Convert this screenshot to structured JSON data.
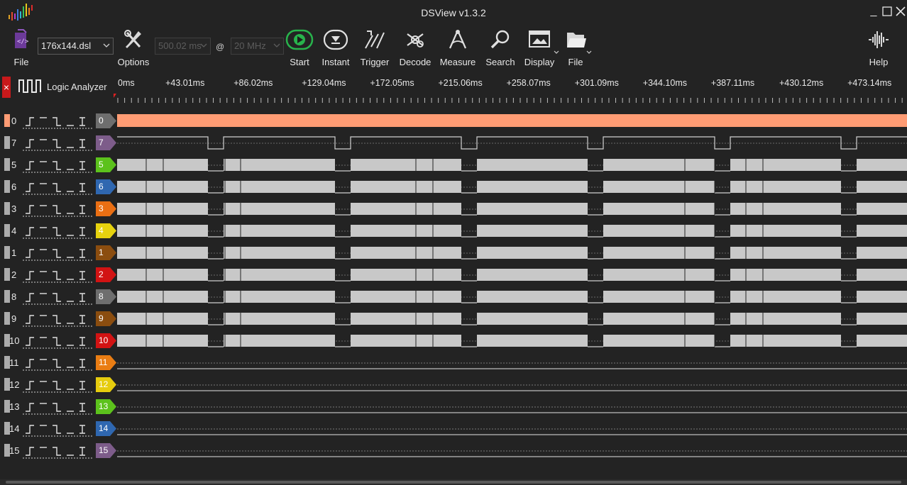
{
  "window": {
    "title": "DSView v1.3.2"
  },
  "toolbar": {
    "file_label": "File",
    "device_file": "176x144.dsl",
    "options_label": "Options",
    "sample_time": "500.02 ms",
    "at_sign": "@",
    "sample_rate": "20 MHz",
    "buttons": [
      {
        "label": "Start",
        "icon": "start-icon"
      },
      {
        "label": "Instant",
        "icon": "instant-icon"
      },
      {
        "label": "Trigger",
        "icon": "trigger-icon"
      },
      {
        "label": "Decode",
        "icon": "decode-icon"
      },
      {
        "label": "Measure",
        "icon": "measure-icon"
      },
      {
        "label": "Search",
        "icon": "search-icon"
      },
      {
        "label": "Display",
        "icon": "display-icon"
      },
      {
        "label": "File",
        "icon": "file-icon"
      }
    ],
    "help_label": "Help"
  },
  "header": {
    "mode_label": "Logic Analyzer",
    "ruler_labels": [
      "0ms",
      "+43.01ms",
      "+86.02ms",
      "+129.04ms",
      "+172.05ms",
      "+215.06ms",
      "+258.07ms",
      "+301.09ms",
      "+344.10ms",
      "+387.11ms",
      "+430.12ms",
      "+473.14ms"
    ]
  },
  "channels": [
    {
      "num": "0",
      "label": "0",
      "color": "#6e6e6e",
      "kind": "high-solid"
    },
    {
      "num": "7",
      "label": "7",
      "color": "#7d5c8a",
      "kind": "pulse"
    },
    {
      "num": "5",
      "label": "5",
      "color": "#5cc21c",
      "kind": "data"
    },
    {
      "num": "6",
      "label": "6",
      "color": "#2f67b0",
      "kind": "data"
    },
    {
      "num": "3",
      "label": "3",
      "color": "#ea6f13",
      "kind": "data"
    },
    {
      "num": "4",
      "label": "4",
      "color": "#e6d20e",
      "kind": "data"
    },
    {
      "num": "1",
      "label": "1",
      "color": "#8b4d0f",
      "kind": "data"
    },
    {
      "num": "2",
      "label": "2",
      "color": "#d21313",
      "kind": "data"
    },
    {
      "num": "8",
      "label": "8",
      "color": "#6e6e6e",
      "kind": "data"
    },
    {
      "num": "9",
      "label": "9",
      "color": "#8b4d0f",
      "kind": "data"
    },
    {
      "num": "10",
      "label": "10",
      "color": "#d21313",
      "kind": "data"
    },
    {
      "num": "11",
      "label": "11",
      "color": "#ea7d13",
      "kind": "low"
    },
    {
      "num": "12",
      "label": "12",
      "color": "#e6cc0e",
      "kind": "low"
    },
    {
      "num": "13",
      "label": "13",
      "color": "#5cc21c",
      "kind": "low"
    },
    {
      "num": "14",
      "label": "14",
      "color": "#2f67b0",
      "kind": "low"
    },
    {
      "num": "15",
      "label": "15",
      "color": "#7d5c8a",
      "kind": "low"
    }
  ],
  "colors": {
    "accent_selected": "#ff9c74",
    "waveform": "#c8c8c8",
    "background": "#232323",
    "start_green": "#28b34c"
  }
}
